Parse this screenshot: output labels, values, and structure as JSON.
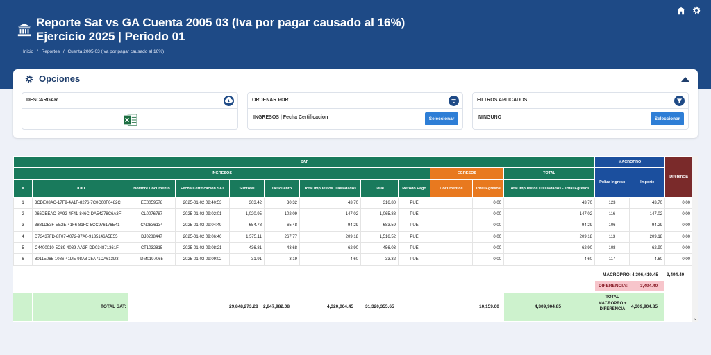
{
  "header": {
    "title_line1": "Reporte Sat vs GA Cuenta 2005 03 (Iva por pagar causado al 16%)",
    "title_line2": "Ejercicio 2025 | Periodo 01",
    "breadcrumb": [
      "Inicio",
      "/",
      "Reportes",
      "/",
      "Cuenta 2005 03 (Iva por pagar causado al 16%)"
    ]
  },
  "options": {
    "title": "Opciones",
    "download_label": "DESCARGAR",
    "order_label": "ORDENAR POR",
    "order_value": "INGRESOS | Fecha Certificacion",
    "filters_label": "FILTROS APLICADOS",
    "filters_value": "NINGUNO",
    "select_label": "Seleccionar"
  },
  "table": {
    "group_sat": "SAT",
    "group_macropro": "MACROPRO",
    "group_diferencia": "Diferencia",
    "group_ingresos": "INGRESOS",
    "group_egresos": "EGRESOS",
    "group_total": "TOTAL",
    "columns": [
      "#",
      "UUID",
      "Nombre Documento",
      "Fecha Certificacion SAT",
      "Subtotal",
      "Descuento",
      "Total Impuestos Trasladados",
      "Total",
      "Metodo Pago",
      "Documentos",
      "Total Egresos",
      "Total Impuestos Trasladados - Total Egresos",
      "Poliza Ingreso",
      "Importe"
    ],
    "rows": [
      [
        "1",
        "3CDE08AC-17F9-4A1F-8276-7C0C00F0482C",
        "EE0059578",
        "2025-01-02 08:40:53",
        "303.42",
        "30.32",
        "43.70",
        "316.80",
        "PUE",
        "",
        "0.00",
        "43.70",
        "123",
        "43.70",
        "0.00"
      ],
      [
        "2",
        "066DEEAC-8A92-4F41-846C-DA54278C6A3F",
        "CL0076787",
        "2025-01-02 09:02:01",
        "1,020.95",
        "102.09",
        "147.02",
        "1,065.88",
        "PUE",
        "",
        "0.00",
        "147.02",
        "116",
        "147.02",
        "0.00"
      ],
      [
        "3",
        "3881D53F-EE2E-41F6-81FC-5CC976176E41",
        "CN0836134",
        "2025-01-02 09:04:49",
        "654.78",
        "65.48",
        "94.29",
        "683.59",
        "PUE",
        "",
        "0.00",
        "94.29",
        "106",
        "94.29",
        "0.00"
      ],
      [
        "4",
        "D73437FD-8F07-4072-97A0-9135146A5E55",
        "DJ0288447",
        "2025-01-02 09:06:46",
        "1,575.11",
        "267.77",
        "209.18",
        "1,516.52",
        "PUE",
        "",
        "0.00",
        "209.18",
        "113",
        "209.18",
        "0.00"
      ],
      [
        "5",
        "C4400010-5C89-4089-AA2F-DD034871361F",
        "CT1032815",
        "2025-01-02 09:08:21",
        "436.81",
        "43.68",
        "62.90",
        "456.03",
        "PUE",
        "",
        "0.00",
        "62.90",
        "108",
        "62.90",
        "0.00"
      ],
      [
        "6",
        "8011E065-1086-41DE-98A8-25A71CA613D3",
        "DM0197065",
        "2025-01-02 09:09:02",
        "31.91",
        "3.19",
        "4.60",
        "33.32",
        "PUE",
        "",
        "0.00",
        "4.60",
        "117",
        "4.60",
        "0.00"
      ]
    ]
  },
  "summary": {
    "macropro_label": "MACROPRO:",
    "macropro_value": "4,306,410.45",
    "macropro_side": "3,494.40",
    "diferencia_label": "DIFERENCIA:",
    "diferencia_value": "3,494.40",
    "total_sat_label": "TOTAL SAT:",
    "total_subtotal": "29,848,273.28",
    "total_descuento": "2,847,982.08",
    "total_impuestos": "4,320,064.45",
    "total_total": "31,320,355.65",
    "total_egresos": "10,159.60",
    "total_diff": "4,309,904.85",
    "total_macropro_label": "TOTAL MACROPRO + DIFERENCIA",
    "total_macropro_value": "4,309,904.85"
  },
  "colors": {
    "header_blue": "#1e4a86",
    "sat_green": "#197a5c",
    "egresos_orange": "#e8791f",
    "macropro_blue": "#1b4f9e",
    "diferencia_red": "#7a2a2a"
  }
}
